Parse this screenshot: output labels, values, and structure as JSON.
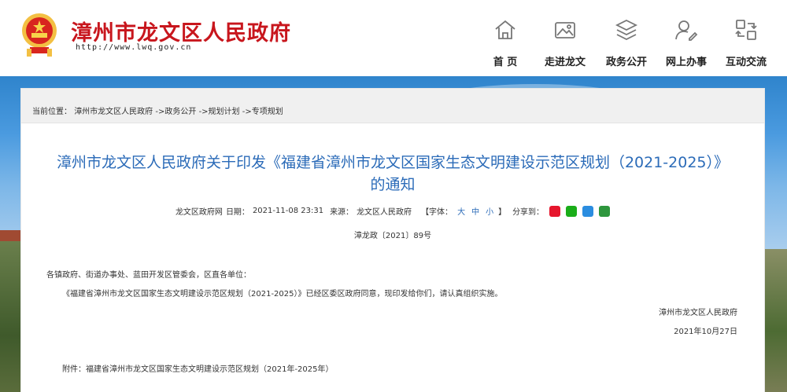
{
  "header": {
    "site_title": "漳州市龙文区人民政府",
    "site_url": "http://www.lwq.gov.cn"
  },
  "nav": {
    "items": [
      {
        "label": "首 页",
        "icon": "home-icon"
      },
      {
        "label": "走进龙文",
        "icon": "picture-icon"
      },
      {
        "label": "政务公开",
        "icon": "layers-icon"
      },
      {
        "label": "网上办事",
        "icon": "user-edit-icon"
      },
      {
        "label": "互动交流",
        "icon": "exchange-icon"
      }
    ]
  },
  "breadcrumb": {
    "prefix": "当前位置：",
    "crumbs": [
      "漳州市龙文区人民政府",
      "->政务公开",
      "->规划计划",
      "->专项规划"
    ]
  },
  "article": {
    "title_line1": "漳州市龙文区人民政府关于印发《福建省漳州市龙文区国家生态文明建设示范区规划（2021-2025）》",
    "title_line2": "的通知",
    "meta_source_site": "龙文区政府网",
    "meta_date_label": "日期：",
    "meta_date": "2021-11-08 23:31",
    "meta_origin_label": "来源：",
    "meta_origin": "龙文区人民政府",
    "font_label": "【字体：",
    "font_large": "大",
    "font_medium": "中",
    "font_small": "小",
    "font_close": "】",
    "share_label": "分享到：",
    "doc_number": "漳龙政〔2021〕89号",
    "salutation": "各镇政府、街道办事处、蓝田开发区管委会，区直各单位：",
    "body": "《福建省漳州市龙文区国家生态文明建设示范区规划（2021-2025）》已经区委区政府同意，现印发给你们，请认真组织实施。",
    "signer": "漳州市龙文区人民政府",
    "sign_date": "2021年10月27日",
    "attachment": "附件：福建省漳州市龙文区国家生态文明建设示范区规划（2021年-2025年）"
  },
  "share_icons": [
    {
      "name": "weibo-share-icon",
      "color": "#e6162d"
    },
    {
      "name": "wechat-share-icon",
      "color": "#1aad19"
    },
    {
      "name": "qq-share-icon",
      "color": "#2b8de0"
    },
    {
      "name": "douban-share-icon",
      "color": "#2e963d"
    }
  ],
  "colors": {
    "brand_red": "#c8161d",
    "title_blue": "#2b6bb8"
  }
}
